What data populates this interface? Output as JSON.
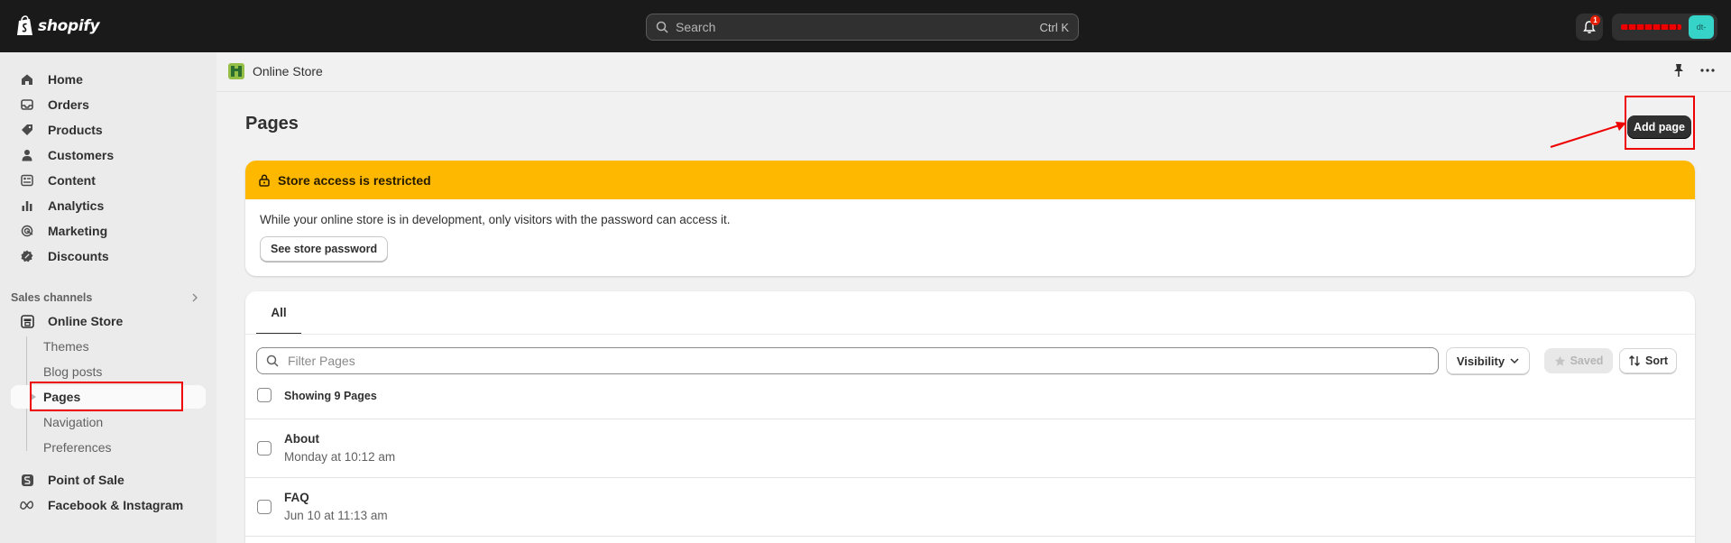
{
  "topbar": {
    "logo_text": "shopify",
    "search_placeholder": "Search",
    "search_shortcut": "Ctrl K",
    "notification_count": "1",
    "avatar_initials": "dt-"
  },
  "sidebar": {
    "items": [
      {
        "label": "Home",
        "icon": "home-icon"
      },
      {
        "label": "Orders",
        "icon": "inbox-icon"
      },
      {
        "label": "Products",
        "icon": "tag-icon"
      },
      {
        "label": "Customers",
        "icon": "person-icon"
      },
      {
        "label": "Content",
        "icon": "content-icon"
      },
      {
        "label": "Analytics",
        "icon": "bar-chart-icon"
      },
      {
        "label": "Marketing",
        "icon": "target-icon"
      },
      {
        "label": "Discounts",
        "icon": "discount-icon"
      }
    ],
    "sales_channels_label": "Sales channels",
    "online_store_label": "Online Store",
    "sub_items": [
      "Themes",
      "Blog posts",
      "Pages",
      "Navigation",
      "Preferences"
    ],
    "active_sub_item": "Pages",
    "point_of_sale_label": "Point of Sale",
    "facebook_label": "Facebook & Instagram"
  },
  "store_bar": {
    "title": "Online Store"
  },
  "page": {
    "title": "Pages",
    "add_button": "Add page"
  },
  "banner": {
    "title": "Store access is restricted",
    "message": "While your online store is in development, only visitors with the password can access it.",
    "button": "See store password",
    "color": "#ffb800"
  },
  "list": {
    "tab": "All",
    "filter_placeholder": "Filter Pages",
    "visibility_label": "Visibility",
    "saved_label": "Saved",
    "sort_label": "Sort",
    "showing_text": "Showing 9 Pages",
    "rows": [
      {
        "title": "About",
        "date": "Monday at 10:12 am"
      },
      {
        "title": "FAQ",
        "date": "Jun 10 at 11:13 am"
      }
    ]
  },
  "annotation_color": "#ee0000"
}
